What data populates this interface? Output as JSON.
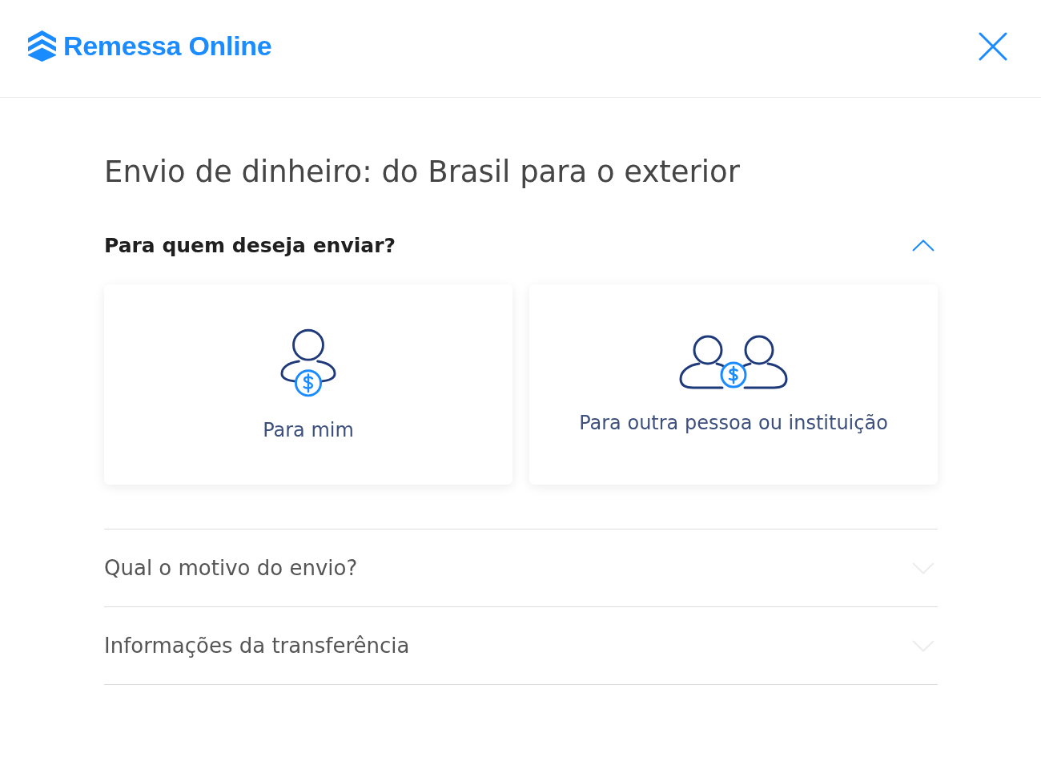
{
  "header": {
    "brand": "Remessa Online"
  },
  "page_title": "Envio de dinheiro: do Brasil para o exterior",
  "sections": [
    {
      "title": "Para quem deseja enviar?",
      "expanded": true,
      "disabled": false,
      "options": [
        {
          "kind": "single",
          "label": "Para mim",
          "selected": false
        },
        {
          "kind": "group",
          "label": "Para outra pessoa ou instituição",
          "selected": false
        }
      ]
    },
    {
      "title": "Qual o motivo do envio?",
      "expanded": false,
      "disabled": true
    },
    {
      "title": "Informações da transferência",
      "expanded": false,
      "disabled": true
    }
  ]
}
